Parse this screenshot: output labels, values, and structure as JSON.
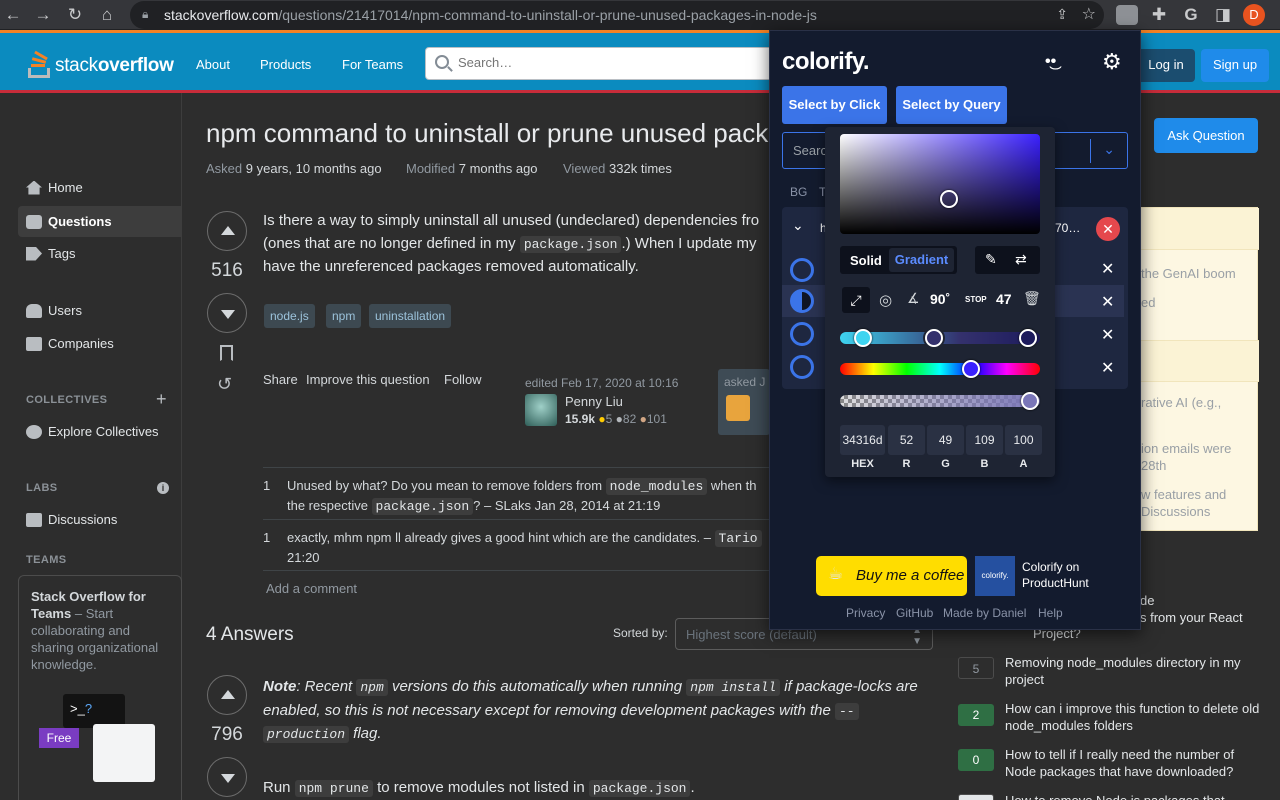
{
  "browser": {
    "url_host": "stackoverflow.com",
    "url_path": "/questions/21417014/npm-command-to-uninstall-or-prune-unused-packages-in-node-js",
    "profile": "D"
  },
  "so": {
    "logo_light": "stack",
    "logo_bold": "overflow",
    "nav": [
      "About",
      "Products",
      "For Teams"
    ],
    "search_placeholder": "Search…",
    "login": "Log in",
    "signup": "Sign up",
    "ask": "Ask Question"
  },
  "leftnav": {
    "items": [
      "Home",
      "Questions",
      "Tags",
      "Users",
      "Companies"
    ],
    "collectives": "COLLECTIVES",
    "explore": "Explore Collectives",
    "labs": "LABS",
    "discussions": "Discussions",
    "teams": "TEAMS",
    "team_title": "Stack Overflow for Teams",
    "team_text": " – Start collaborating and sharing organizational knowledge.",
    "free": "Free"
  },
  "question": {
    "title": "npm command to uninstall or prune unused pack",
    "asked_label": "Asked",
    "asked": "9 years, 10 months ago",
    "modified_label": "Modified",
    "modified": "7 months ago",
    "viewed_label": "Viewed",
    "viewed": "332k times",
    "votes": "516",
    "body1": "Is there a way to simply uninstall all unused (undeclared) dependencies fro",
    "body2a": "(ones that are no longer defined in my ",
    "body2code": "package.json",
    "body2b": ".) When I update my",
    "body3": "have the unreferenced packages removed automatically.",
    "tags": [
      "node.js",
      "npm",
      "uninstallation"
    ],
    "post_links": [
      "Share",
      "Improve this question",
      "Follow"
    ],
    "edited": "edited Feb 17, 2020 at 10:16",
    "editor": "Penny Liu",
    "rep": "15.9k",
    "gold": "5",
    "silver": "82",
    "bronze": "101",
    "asked_card": "asked J"
  },
  "comments": [
    {
      "n": "1",
      "a": "Unused by what? Do you mean to remove folders from ",
      "code1": "node_modules",
      "b": " when th",
      "c": "the respective ",
      "code2": "package.json",
      "d": "? – SLaks Jan 28, 2014 at 21:19"
    },
    {
      "n": "1",
      "a": "exactly, mhm npm ll already gives a good hint which are the candidates. – ",
      "code1": "Tario",
      "d": "21:20"
    }
  ],
  "add_comment": "Add a comment",
  "answers": {
    "heading": "4 Answers",
    "sorted_label": "Sorted by:",
    "sort_value": "Highest score (default)",
    "votes": "796",
    "a1_note": "Note",
    "a1_t1": ": Recent ",
    "a1_c1": "npm",
    "a1_t2": " versions do this automatically when running ",
    "a1_c2": "npm install",
    "a1_t3": " if package-locks",
    "a1_l2": "are enabled, so this is not necessary except for removing development packages with the ",
    "a1_c3": "--",
    "a1_c4": "production",
    "a1_t4": " flag.",
    "a2_t1": "Run ",
    "a2_c1": "npm prune",
    "a2_t2": " to remove modules not listed in ",
    "a2_c2": "package.json",
    "a2_t3": "."
  },
  "sidebar": {
    "frag1": "the GenAI boom",
    "frag2": "ed",
    "frag3": "rative AI (e.g.,",
    "frag4": "ion emails were",
    "frag5": "28th",
    "frag6": "w features and",
    "frag7": "Discussions",
    "rel_frag": "de",
    "rel_frag2": "s from your React",
    "rel_frag3": "Project?",
    "related": [
      {
        "count": "5",
        "title": "Removing node_modules directory in my project",
        "answered": false
      },
      {
        "count": "2",
        "title": "How can i improve this function to delete old node_modules folders",
        "answered": true
      },
      {
        "count": "0",
        "title": "How to tell if I really need the number of Node packages that have downloaded?",
        "answered": true
      },
      {
        "count": "",
        "title": "How to remove Node.js packages that",
        "answered": false
      }
    ]
  },
  "colorify": {
    "logo": "colorify.",
    "select_click": "Select by Click",
    "select_query": "Select by Query",
    "search_placeholder": "Searc",
    "tabs": [
      "BG",
      "T"
    ],
    "row_frag": "70…",
    "solid": "Solid",
    "gradient": "Gradient",
    "angle": "90",
    "stop_label": "STOP",
    "stop": "47",
    "values": [
      {
        "v": "34316d",
        "l": "HEX"
      },
      {
        "v": "52",
        "l": "R"
      },
      {
        "v": "49",
        "l": "G"
      },
      {
        "v": "109",
        "l": "B"
      },
      {
        "v": "100",
        "l": "A"
      }
    ],
    "coffee": "Buy me a coffee",
    "ph_badge": "colorify.",
    "ph_text1": "Colorify on",
    "ph_text2": "ProductHunt",
    "footer": [
      "Privacy",
      "GitHub",
      "Made by Daniel",
      "Help"
    ],
    "colors": {
      "accent": "#3b74e8",
      "panel": "#131b2e",
      "close": "#e5484d"
    }
  }
}
